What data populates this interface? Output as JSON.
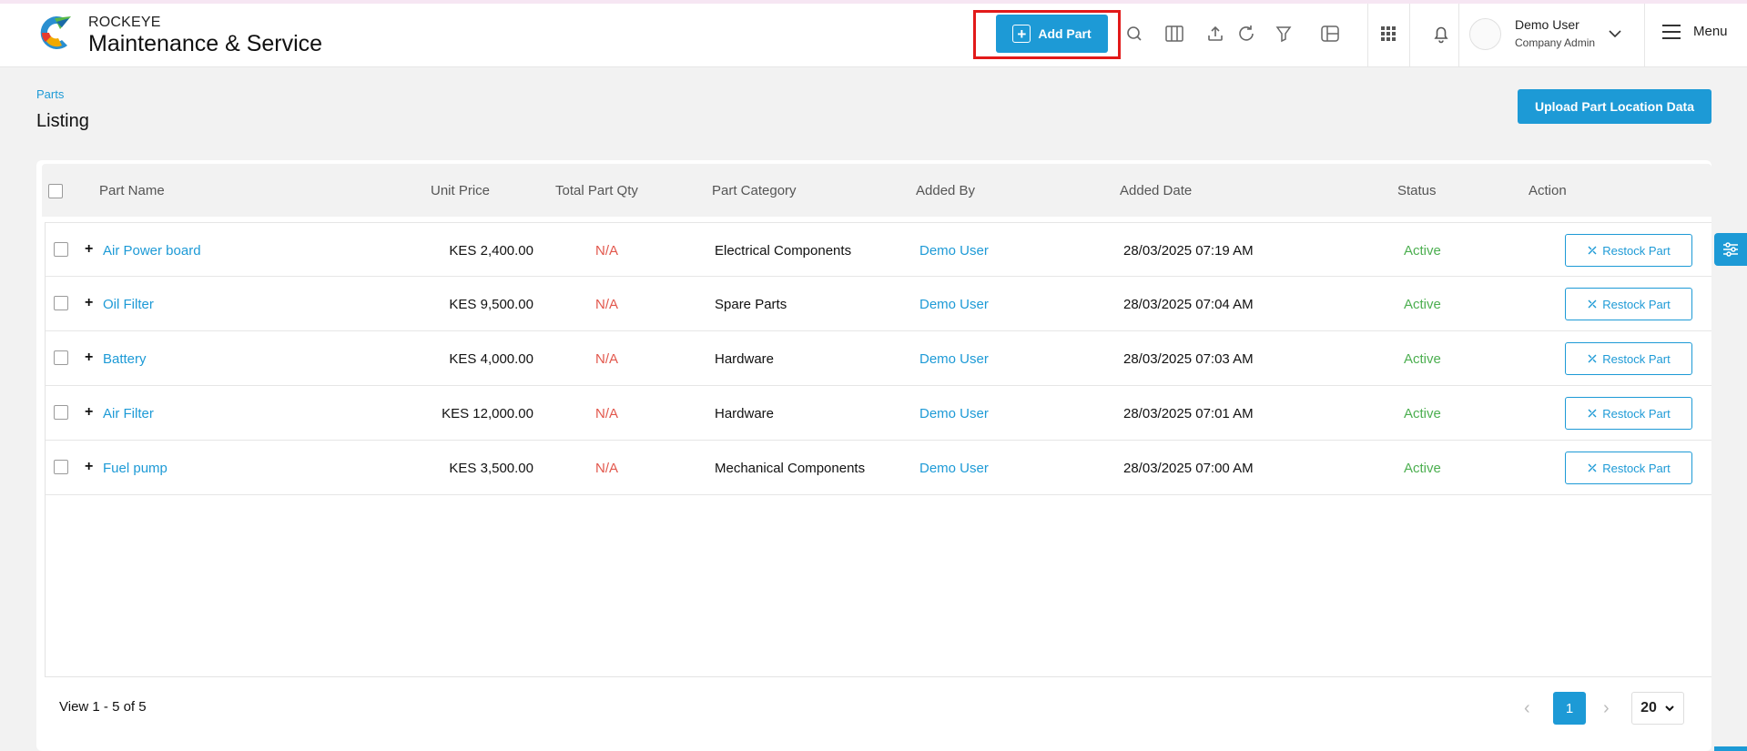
{
  "app": {
    "brand_top": "ROCKEYE",
    "brand_main": "Maintenance & Service"
  },
  "toolbar": {
    "add_part_label": "Add Part",
    "icons": [
      "search-icon",
      "columns-icon",
      "upload-icon",
      "refresh-icon",
      "filter-icon",
      "layout-icon",
      "apps-grid-icon",
      "bell-icon"
    ]
  },
  "user": {
    "name": "Demo User",
    "role": "Company Admin",
    "menu_label": "Menu"
  },
  "breadcrumb": "Parts",
  "page_title": "Listing",
  "upload_label": "Upload Part Location Data",
  "table": {
    "columns": [
      "Part Name",
      "Unit Price",
      "Total Part Qty",
      "Part Category",
      "Added By",
      "Added Date",
      "Status",
      "Action"
    ],
    "rows": [
      {
        "name": "Air Power board",
        "price": "KES 2,400.00",
        "qty": "N/A",
        "category": "Electrical Components",
        "added_by": "Demo User",
        "date": "28/03/2025 07:19 AM",
        "status": "Active",
        "action": "Restock Part"
      },
      {
        "name": "Oil Filter",
        "price": "KES 9,500.00",
        "qty": "N/A",
        "category": "Spare Parts",
        "added_by": "Demo User",
        "date": "28/03/2025 07:04 AM",
        "status": "Active",
        "action": "Restock Part"
      },
      {
        "name": "Battery",
        "price": "KES 4,000.00",
        "qty": "N/A",
        "category": "Hardware",
        "added_by": "Demo User",
        "date": "28/03/2025 07:03 AM",
        "status": "Active",
        "action": "Restock Part"
      },
      {
        "name": "Air Filter",
        "price": "KES 12,000.00",
        "qty": "N/A",
        "category": "Hardware",
        "added_by": "Demo User",
        "date": "28/03/2025 07:01 AM",
        "status": "Active",
        "action": "Restock Part"
      },
      {
        "name": "Fuel pump",
        "price": "KES 3,500.00",
        "qty": "N/A",
        "category": "Mechanical Components",
        "added_by": "Demo User",
        "date": "28/03/2025 07:00 AM",
        "status": "Active",
        "action": "Restock Part"
      }
    ]
  },
  "pagination": {
    "summary": "View 1 - 5 of 5",
    "current_page": "1",
    "page_size": "20"
  },
  "colors": {
    "accent": "#1d9ad6",
    "highlight_border": "#e21a1a",
    "status_active": "#4caf50",
    "na_text": "#e2574c"
  }
}
